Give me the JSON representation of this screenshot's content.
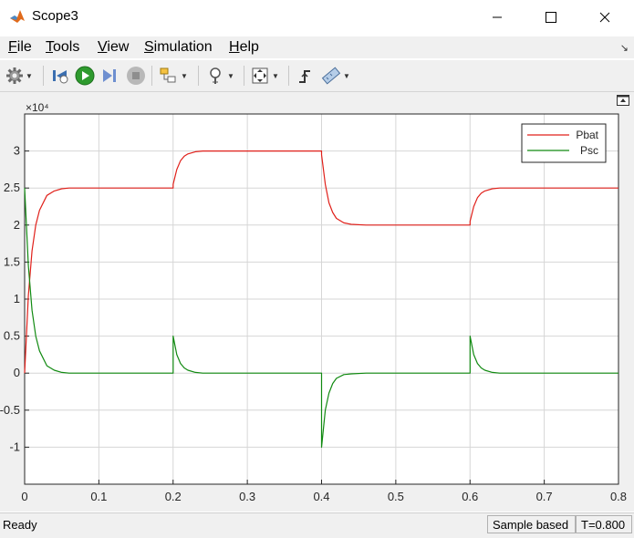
{
  "window": {
    "title": "Scope3"
  },
  "menu": {
    "items": [
      {
        "label": "File",
        "mnemonic": "F",
        "rest": "ile"
      },
      {
        "label": "Tools",
        "mnemonic": "T",
        "rest": "ools"
      },
      {
        "label": "View",
        "mnemonic": "V",
        "rest": "iew"
      },
      {
        "label": "Simulation",
        "mnemonic": "S",
        "rest": "imulation"
      },
      {
        "label": "Help",
        "mnemonic": "H",
        "rest": "elp"
      }
    ]
  },
  "toolbar": {
    "icons": [
      "gear-icon",
      "step-back-icon",
      "run-icon",
      "step-forward-icon",
      "stop-icon",
      "highlight-block-icon",
      "zoom-icon",
      "autoscale-icon",
      "triggers-icon",
      "cursor-measurements-icon"
    ]
  },
  "status": {
    "ready": "Ready",
    "mode": "Sample based",
    "time": "T=0.800"
  },
  "colors": {
    "pbat": "#e0201a",
    "psc": "#118a11",
    "grid": "#d6d6d6",
    "axes_bg": "#ffffff",
    "frame": "#f0f0f0"
  },
  "chart_data": {
    "type": "line",
    "exponent_label": "×10⁴",
    "xlim": [
      0,
      0.8
    ],
    "ylim": [
      -1.5,
      3.5
    ],
    "xticks": [
      "0",
      "0.1",
      "0.2",
      "0.3",
      "0.4",
      "0.5",
      "0.6",
      "0.7",
      "0.8"
    ],
    "xtick_values": [
      0,
      0.1,
      0.2,
      0.3,
      0.4,
      0.5,
      0.6,
      0.7,
      0.8
    ],
    "yticks": [
      "-1",
      "-0.5",
      "0",
      "0.5",
      "1",
      "1.5",
      "2",
      "2.5",
      "3"
    ],
    "ytick_values": [
      -1,
      -0.5,
      0,
      0.5,
      1,
      1.5,
      2,
      2.5,
      3
    ],
    "grid": true,
    "legend_position": "top-right",
    "series": [
      {
        "name": "Pbat",
        "color": "#e0201a",
        "x": [
          0,
          0.005,
          0.01,
          0.015,
          0.02,
          0.03,
          0.04,
          0.05,
          0.06,
          0.08,
          0.1,
          0.2,
          0.2,
          0.205,
          0.21,
          0.215,
          0.22,
          0.23,
          0.24,
          0.26,
          0.3,
          0.4,
          0.4,
          0.405,
          0.41,
          0.415,
          0.42,
          0.43,
          0.44,
          0.46,
          0.5,
          0.6,
          0.6,
          0.605,
          0.61,
          0.615,
          0.62,
          0.63,
          0.64,
          0.66,
          0.7,
          0.8
        ],
        "y": [
          0,
          1.05,
          1.65,
          2.0,
          2.2,
          2.4,
          2.46,
          2.49,
          2.5,
          2.5,
          2.5,
          2.5,
          2.55,
          2.75,
          2.87,
          2.93,
          2.96,
          2.99,
          3.0,
          3.0,
          3.0,
          3.0,
          2.95,
          2.55,
          2.3,
          2.17,
          2.09,
          2.03,
          2.01,
          2.0,
          2.0,
          2.0,
          2.05,
          2.25,
          2.37,
          2.43,
          2.46,
          2.49,
          2.5,
          2.5,
          2.5,
          2.5
        ]
      },
      {
        "name": "Psc",
        "color": "#118a11",
        "x": [
          0,
          0.005,
          0.01,
          0.015,
          0.02,
          0.03,
          0.04,
          0.05,
          0.06,
          0.08,
          0.1,
          0.2,
          0.2,
          0.205,
          0.21,
          0.215,
          0.22,
          0.23,
          0.24,
          0.26,
          0.3,
          0.4,
          0.4,
          0.405,
          0.41,
          0.415,
          0.42,
          0.43,
          0.44,
          0.46,
          0.5,
          0.6,
          0.6,
          0.605,
          0.61,
          0.615,
          0.62,
          0.63,
          0.64,
          0.66,
          0.7,
          0.8
        ],
        "y": [
          2.5,
          1.45,
          0.85,
          0.5,
          0.3,
          0.1,
          0.04,
          0.01,
          0.0,
          0.0,
          0.0,
          0.0,
          0.5,
          0.25,
          0.13,
          0.07,
          0.04,
          0.01,
          0.0,
          0.0,
          0.0,
          0.0,
          -1.0,
          -0.5,
          -0.27,
          -0.14,
          -0.07,
          -0.02,
          -0.01,
          0.0,
          0.0,
          0.0,
          0.5,
          0.25,
          0.13,
          0.07,
          0.04,
          0.01,
          0.0,
          0.0,
          0.0,
          0.0
        ]
      }
    ]
  }
}
